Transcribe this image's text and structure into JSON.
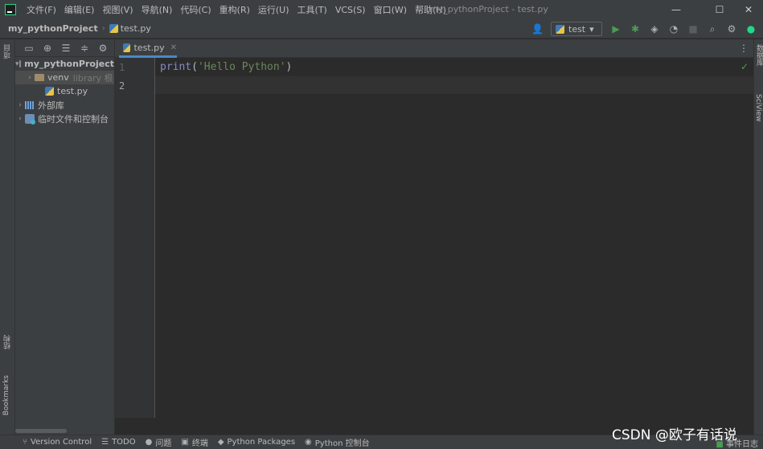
{
  "menubar": {
    "items": [
      "文件(F)",
      "编辑(E)",
      "视图(V)",
      "导航(N)",
      "代码(C)",
      "重构(R)",
      "运行(U)",
      "工具(T)",
      "VCS(S)",
      "窗口(W)",
      "帮助(H)"
    ],
    "window_title": "my_pythonProject - test.py",
    "controls": {
      "minimize": "—",
      "maximize": "☐",
      "close": "✕"
    }
  },
  "navbar": {
    "project": "my_pythonProject",
    "file": "test.py",
    "run_config": "test"
  },
  "left_stripe": {
    "project_tab": "项目",
    "structure_tab": "结构",
    "bookmarks_tab": "Bookmarks"
  },
  "right_stripe": {
    "database_tab": "数据库",
    "sciview_tab": "SciView"
  },
  "project_tree": {
    "root": "my_pythonProject",
    "venv": "venv",
    "venv_hint": "library 根",
    "file": "test.py",
    "external": "外部库",
    "scratches": "临时文件和控制台"
  },
  "editor": {
    "tab": "test.py",
    "lines": [
      {
        "no": "1",
        "func": "print",
        "open": "(",
        "str": "'Hello Python'",
        "close": ")"
      },
      {
        "no": "2"
      }
    ]
  },
  "statusbar": {
    "version_control": "Version Control",
    "todo": "TODO",
    "problems": "问题",
    "terminal": "终端",
    "python_packages": "Python Packages",
    "python_console": "Python 控制台",
    "event_log": "事件日志"
  },
  "watermark": "CSDN @欧子有话说"
}
